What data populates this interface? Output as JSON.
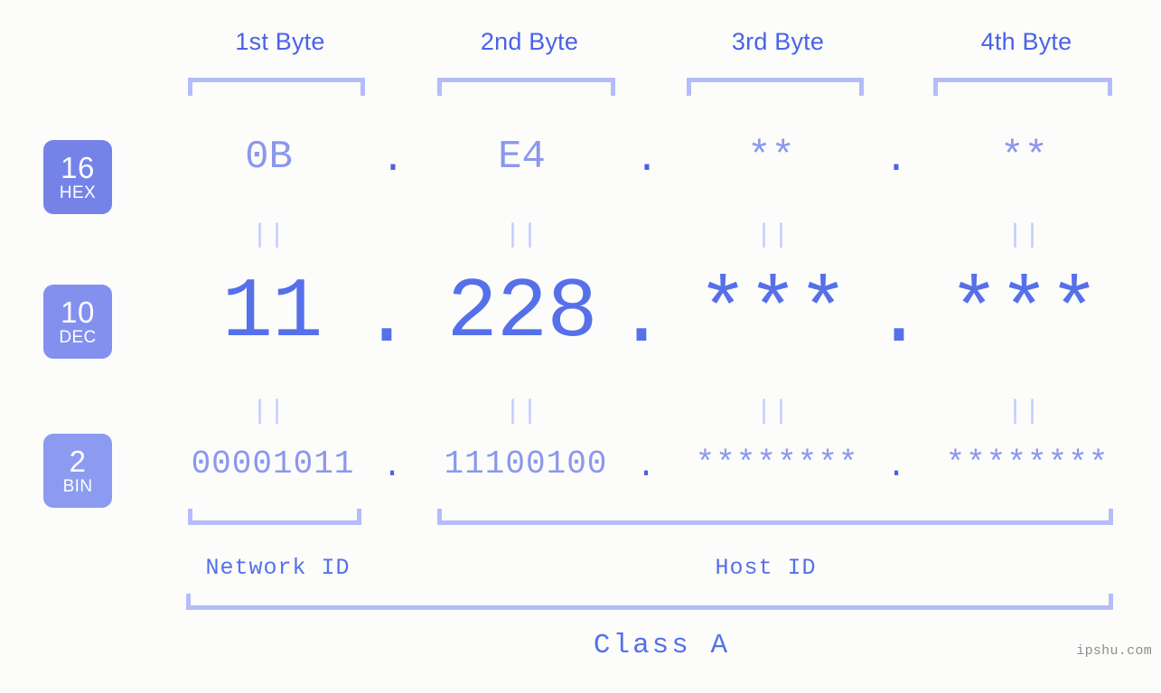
{
  "page": {
    "background_color": "#fcfdfa",
    "accent_dark": "#4a62e8",
    "accent_mid": "#5670ea",
    "accent_light": "#8b97ee",
    "accent_pale": "#b4bcfb",
    "watermark": "ipshu.com"
  },
  "byte_headers": [
    {
      "label": "1st Byte"
    },
    {
      "label": "2nd Byte"
    },
    {
      "label": "3rd Byte"
    },
    {
      "label": "4th Byte"
    }
  ],
  "radix_badges": [
    {
      "number": "16",
      "name": "HEX",
      "color": "#7583e8"
    },
    {
      "number": "10",
      "name": "DEC",
      "color": "#8390ee"
    },
    {
      "number": "2",
      "name": "BIN",
      "color": "#8c9bf0"
    }
  ],
  "rows": {
    "hex": {
      "values": [
        "0B",
        "E4",
        "**",
        "**"
      ],
      "separators": [
        ".",
        ".",
        "."
      ]
    },
    "dec": {
      "values": [
        "11",
        "228",
        "***",
        "***"
      ],
      "separators": [
        ".",
        ".",
        "."
      ]
    },
    "bin": {
      "values": [
        "00001011",
        "11100100",
        "********",
        "********"
      ],
      "separators": [
        ".",
        ".",
        "."
      ]
    }
  },
  "connectors": {
    "symbol": "||",
    "rows": 2,
    "columns": 4
  },
  "id_sections": [
    {
      "label": "Network ID"
    },
    {
      "label": "Host ID"
    }
  ],
  "class_label": "Class A"
}
